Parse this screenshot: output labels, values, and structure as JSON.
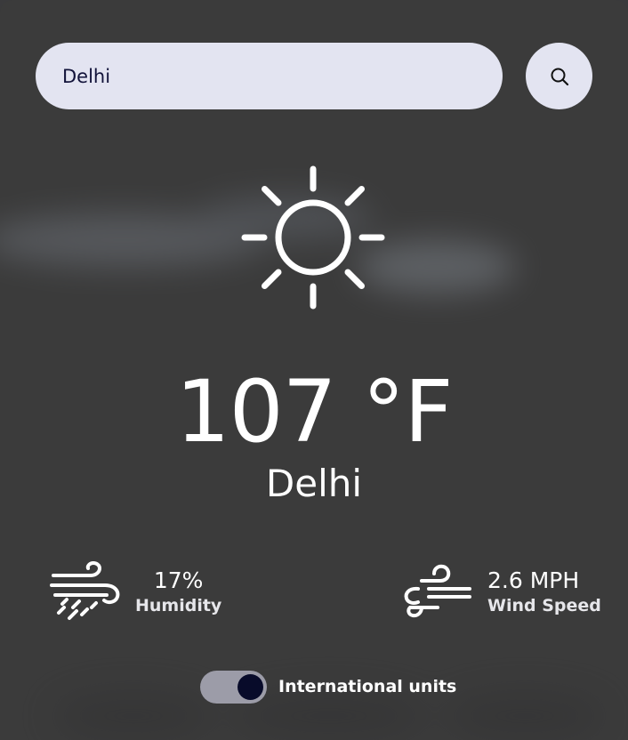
{
  "search": {
    "value": "Delhi",
    "button_icon": "search-icon"
  },
  "weather": {
    "icon": "sun-icon",
    "temperature": "107 °F",
    "city": "Delhi"
  },
  "humidity": {
    "icon": "humidity-icon",
    "value": "17%",
    "label": "Humidity"
  },
  "wind": {
    "icon": "wind-icon",
    "value": "2.6 MPH",
    "label": "Wind Speed"
  },
  "units_toggle": {
    "label": "International units",
    "checked": true
  },
  "colors": {
    "card_background": "#3b3b3b",
    "input_background": "#e3e4f1",
    "toggle_track": "#9c9ca8",
    "toggle_knob": "#080b2a",
    "text": "#ffffff"
  }
}
